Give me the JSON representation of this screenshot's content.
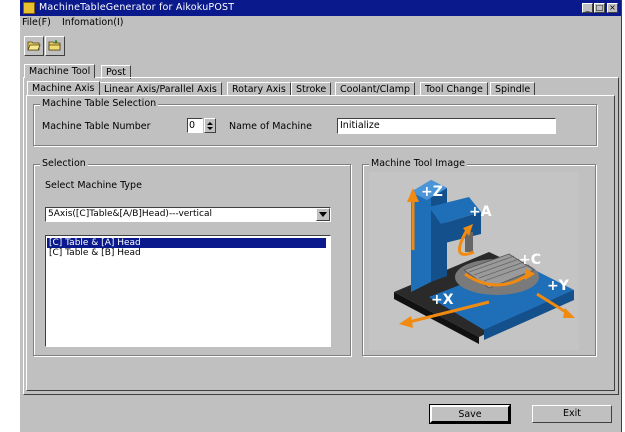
{
  "window": {
    "title": "MachineTableGenerator for AikokuPOST",
    "minimize_glyph": "_",
    "maximize_glyph": "□",
    "close_glyph": "×"
  },
  "menu": {
    "file": "File(F)",
    "info": "Infomation(I)"
  },
  "toolbar": {
    "new_icon": "folder-open-icon",
    "open_icon": "folder-icon"
  },
  "outer_tabs": [
    "Machine Tool",
    "Post"
  ],
  "inner_tabs": [
    "Machine Axis",
    "Linear Axis/Parallel Axis",
    "Rotary Axis",
    "Stroke",
    "Coolant/Clamp",
    "Tool Change",
    "Spindle"
  ],
  "machine_table": {
    "group_title": "Machine Table Selection",
    "number_label": "Machine Table Number",
    "number_value": "0",
    "name_label": "Name of Machine",
    "name_value": "Initialize"
  },
  "selection": {
    "group_title": "Selection",
    "type_label": "Select Machine Type",
    "type_value": "5Axis([C]Table&[A/B]Head)---vertical",
    "list_items": [
      "[C] Table & [A] Head",
      "[C] Table & [B] Head"
    ],
    "selected_index": 0
  },
  "image_panel": {
    "group_title": "Machine Tool Image",
    "axis_labels": [
      "+Z",
      "+A",
      "+C",
      "+X",
      "+Y"
    ]
  },
  "buttons": {
    "save": "Save",
    "exit": "Exit"
  },
  "colors": {
    "titlebar": "#0a1a8c",
    "face": "#c0c0c0",
    "machine_blue": "#1f6fb8",
    "arrow_orange": "#f08a10"
  }
}
